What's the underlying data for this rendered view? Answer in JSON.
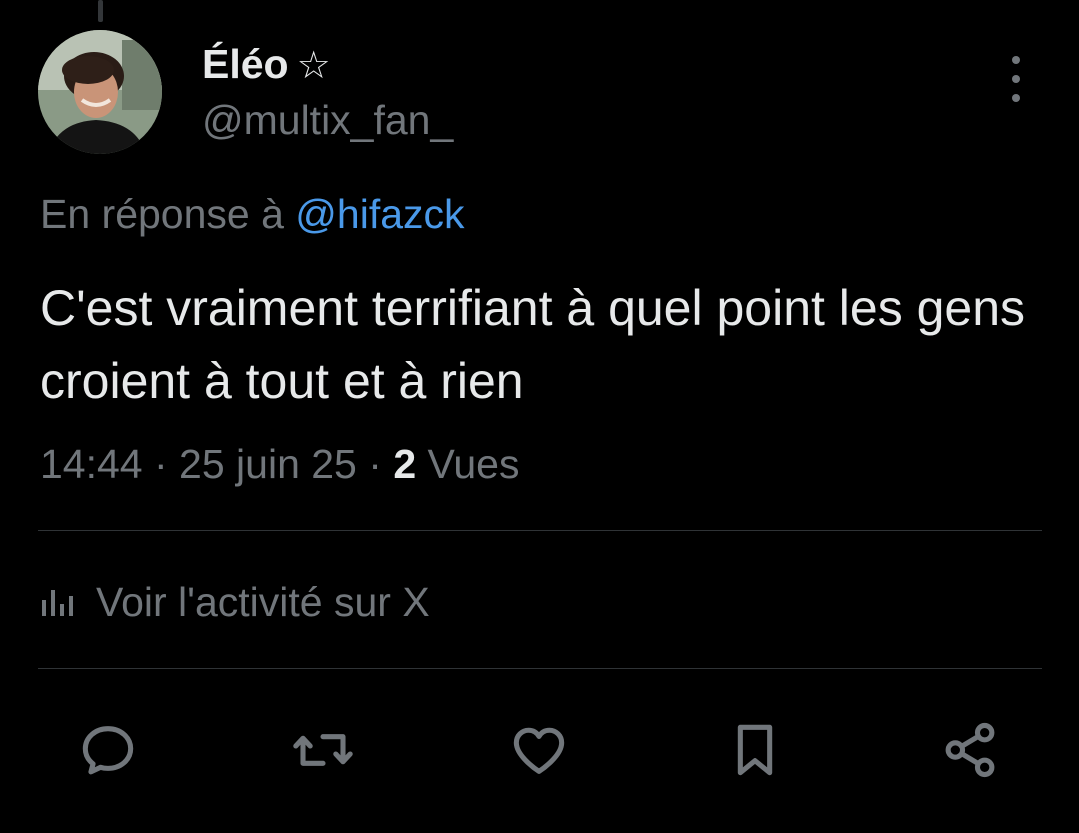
{
  "author": {
    "display_name": "Éléo",
    "badge": "☆",
    "handle": "@multix_fan_"
  },
  "reply_context": {
    "prefix": "En réponse à ",
    "mention": "@hifazck"
  },
  "tweet": {
    "text": "C'est vraiment terrifiant à quel point les gens croient à tout et à rien"
  },
  "meta": {
    "time": "14:44",
    "separator": " · ",
    "date": "25 juin 25",
    "views_count": "2",
    "views_label": "Vues"
  },
  "activity": {
    "label": "Voir l'activité sur X",
    "icon": "analytics-icon"
  },
  "actions": [
    {
      "icon": "reply-icon"
    },
    {
      "icon": "repost-icon"
    },
    {
      "icon": "like-icon"
    },
    {
      "icon": "bookmark-icon"
    },
    {
      "icon": "share-icon"
    }
  ],
  "colors": {
    "background": "#000000",
    "primary_text": "#e7e9ea",
    "secondary_text": "#71767b",
    "link": "#4a99e9",
    "divider": "#2f3336"
  }
}
